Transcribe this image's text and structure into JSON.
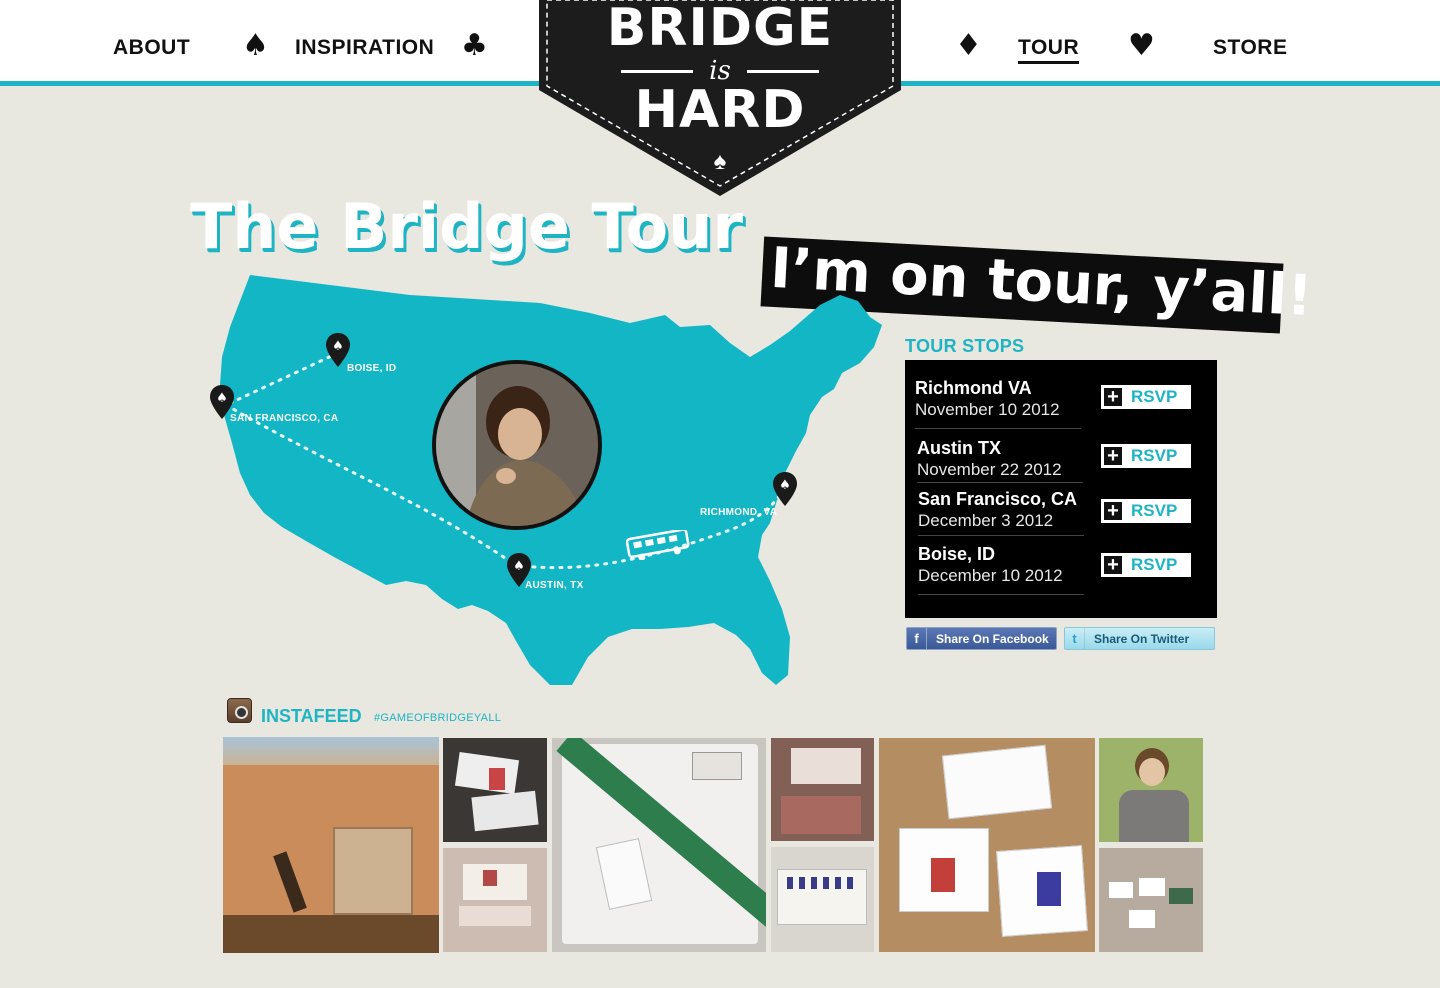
{
  "nav": {
    "about": "ABOUT",
    "inspiration": "INSPIRATION",
    "tour": "TOUR",
    "store": "STORE",
    "suits": [
      "♠",
      "♣",
      "♦",
      "♥"
    ]
  },
  "logo": {
    "line1": "BRIDGE",
    "line2": "is",
    "line3": "HARD",
    "spade": "♠"
  },
  "hero": {
    "title": "The Bridge Tour",
    "banner": "I’m on tour, y’all!"
  },
  "map": {
    "cities": [
      {
        "label": "BOISE, ID"
      },
      {
        "label": "SAN FRANCISCO, CA"
      },
      {
        "label": "RICHMOND, VA"
      },
      {
        "label": "AUSTIN, TX"
      }
    ]
  },
  "tour_stops": {
    "heading": "TOUR STOPS",
    "rsvp_label": "RSVP",
    "stops": [
      {
        "city": "Richmond VA",
        "date": "November 10 2012"
      },
      {
        "city": "Austin TX",
        "date": "November 22 2012"
      },
      {
        "city": "San Francisco, CA",
        "date": "December 3 2012"
      },
      {
        "city": "Boise, ID",
        "date": "December 10 2012"
      }
    ]
  },
  "share": {
    "facebook": "Share On Facebook",
    "twitter": "Share On Twitter"
  },
  "instafeed": {
    "heading": "INSTAFEED",
    "hashtag": "#GAMEOFBRIDGEYALL"
  },
  "colors": {
    "accent": "#1fb4c4",
    "background": "#e8e7e0",
    "logo_bg": "#1c1c1c"
  }
}
